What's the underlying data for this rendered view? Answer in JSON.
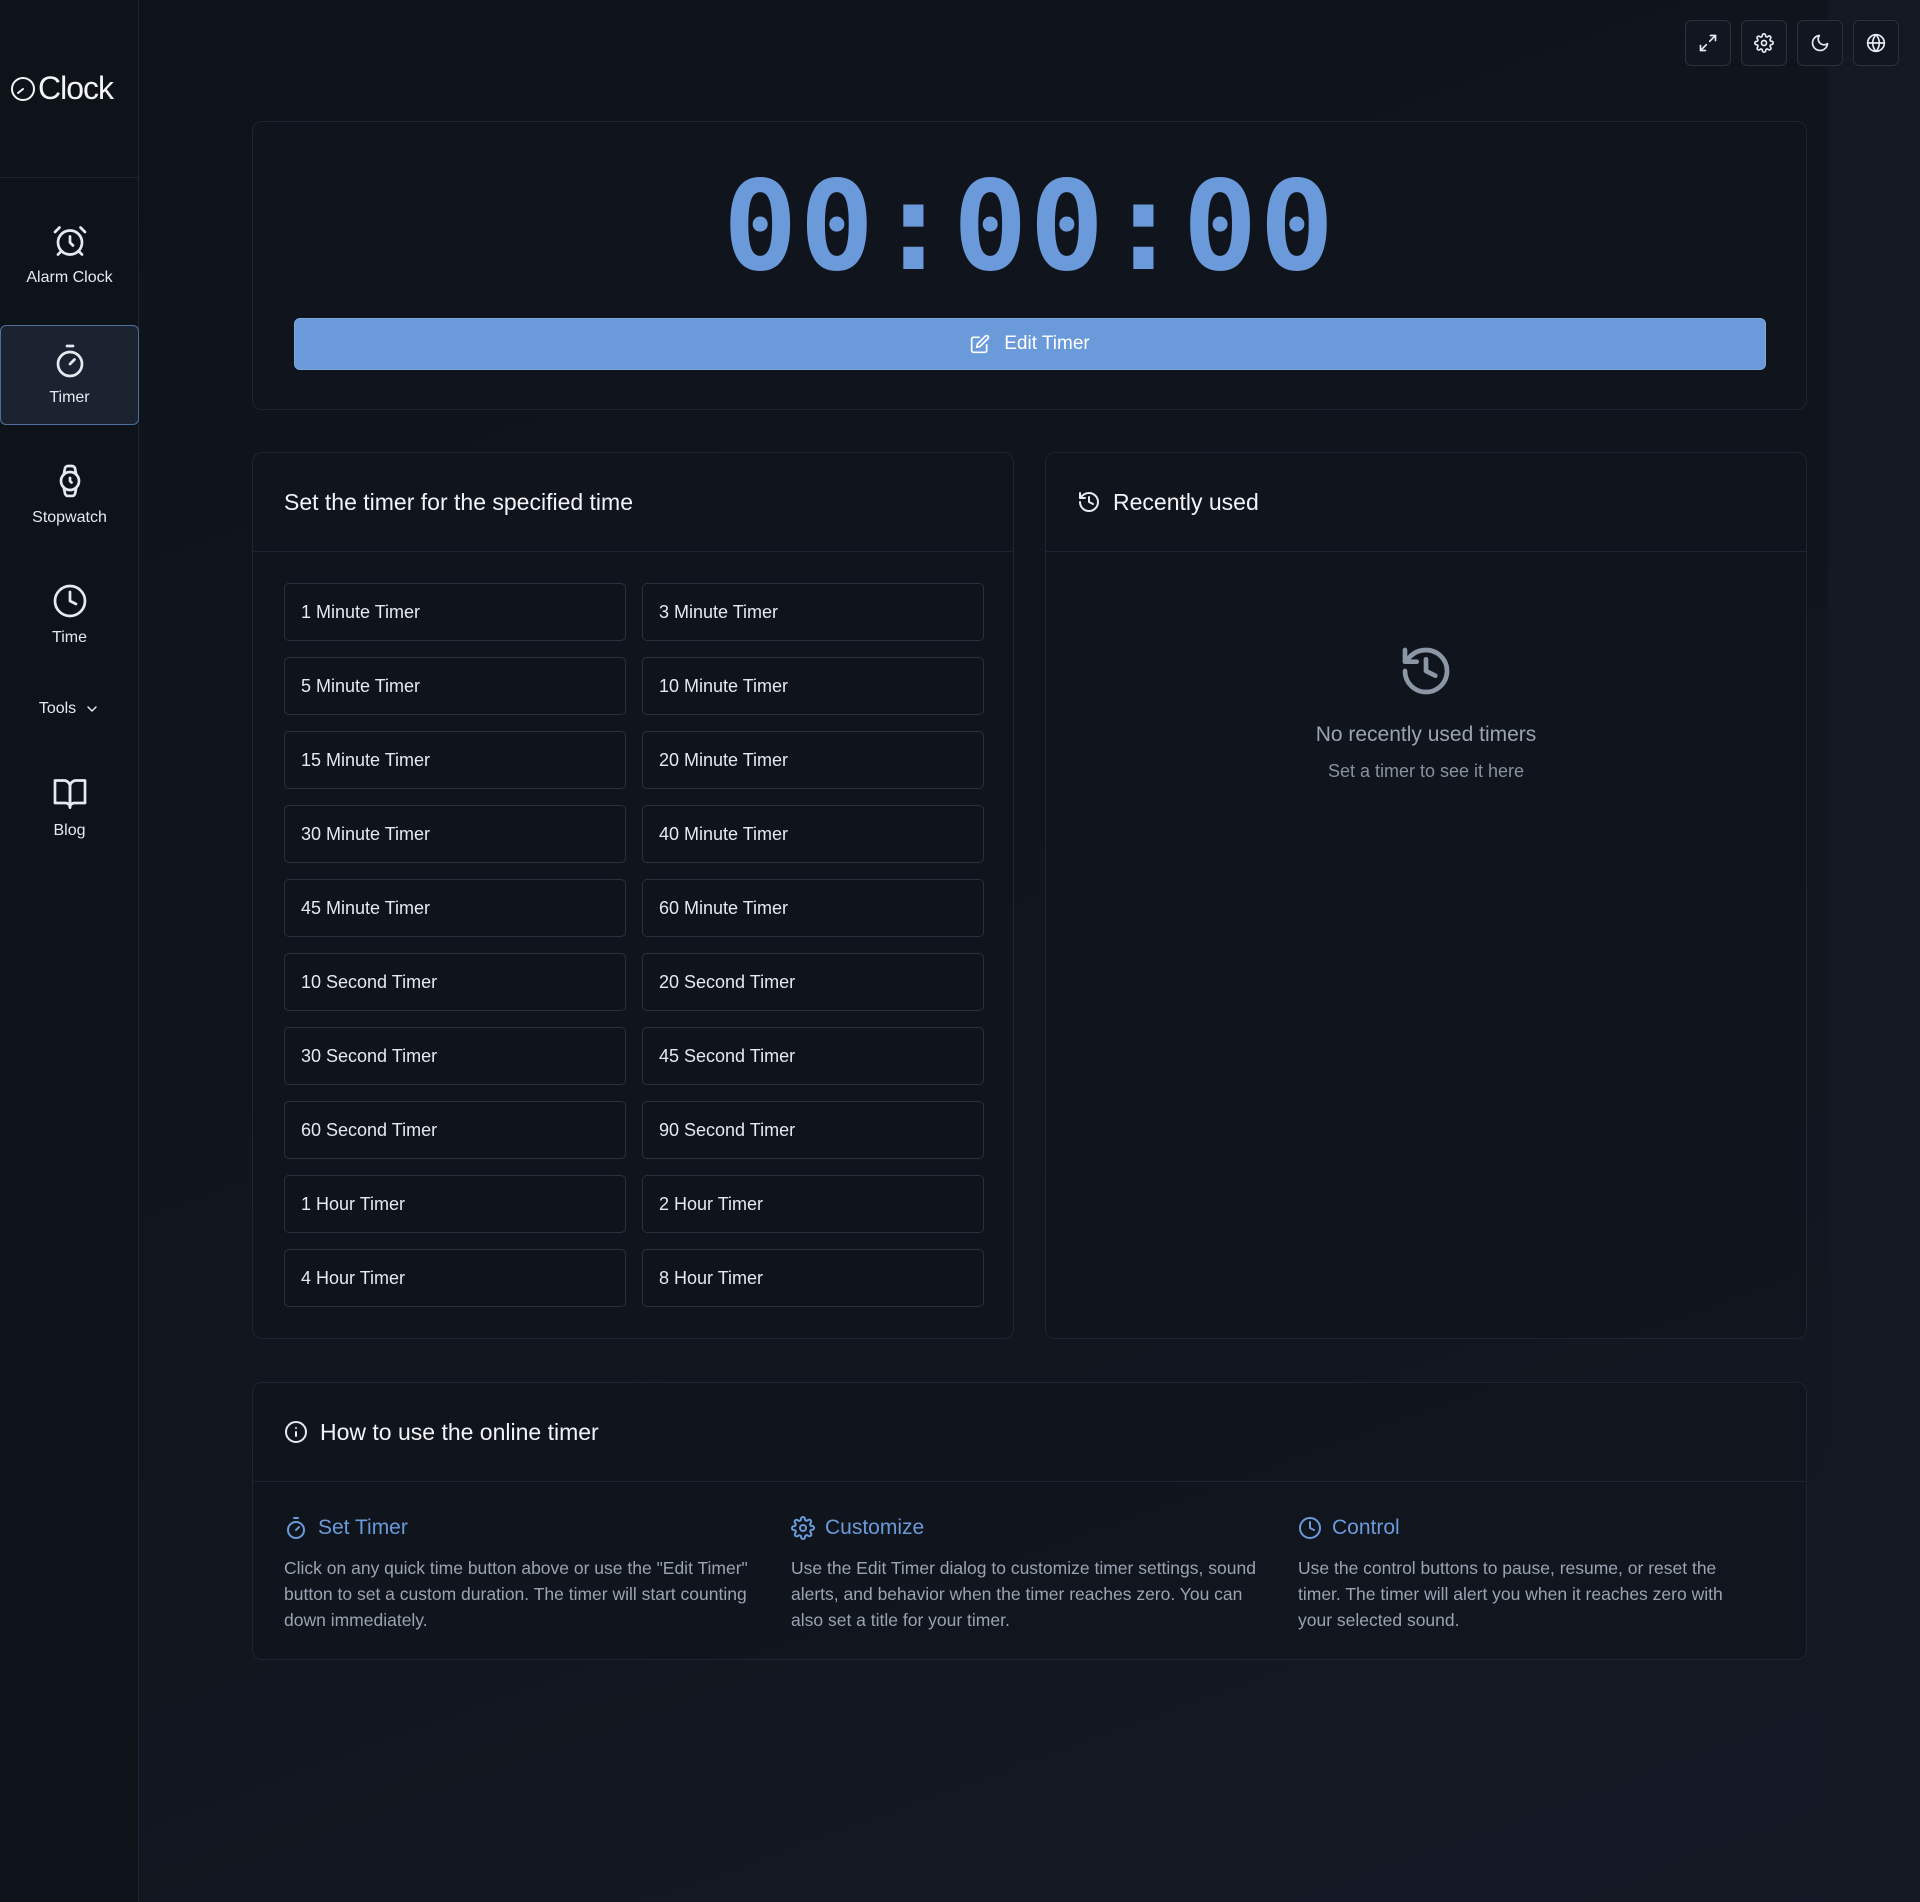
{
  "app": {
    "logo_text": "Clock"
  },
  "sidebar": {
    "items": [
      {
        "label": "Alarm Clock",
        "icon": "alarm-clock-icon"
      },
      {
        "label": "Timer",
        "icon": "timer-icon",
        "active": true
      },
      {
        "label": "Stopwatch",
        "icon": "stopwatch-icon"
      },
      {
        "label": "Time",
        "icon": "clock-icon"
      }
    ],
    "tools_label": "Tools",
    "blog_label": "Blog"
  },
  "topbar": {
    "buttons": [
      "fullscreen-icon",
      "settings-icon",
      "moon-icon",
      "globe-icon"
    ]
  },
  "timer": {
    "display": "00:00:00",
    "edit_label": "Edit Timer"
  },
  "presets": {
    "title": "Set the timer for the specified time",
    "items": [
      "1 Minute Timer",
      "3 Minute Timer",
      "5 Minute Timer",
      "10 Minute Timer",
      "15 Minute Timer",
      "20 Minute Timer",
      "30 Minute Timer",
      "40 Minute Timer",
      "45 Minute Timer",
      "60 Minute Timer",
      "10 Second Timer",
      "20 Second Timer",
      "30 Second Timer",
      "45 Second Timer",
      "60 Second Timer",
      "90 Second Timer",
      "1 Hour Timer",
      "2 Hour Timer",
      "4 Hour Timer",
      "8 Hour Timer"
    ]
  },
  "recent": {
    "title": "Recently used",
    "empty_title": "No recently used timers",
    "empty_subtitle": "Set a timer to see it here"
  },
  "howto": {
    "title": "How to use the online timer",
    "sections": [
      {
        "title": "Set Timer",
        "icon": "timer-icon",
        "text": "Click on any quick time button above or use the \"Edit Timer\" button to set a custom duration. The timer will start counting down immediately."
      },
      {
        "title": "Customize",
        "icon": "gear-icon",
        "text": "Use the Edit Timer dialog to customize timer settings, sound alerts, and behavior when the timer reaches zero. You can also set a title for your timer."
      },
      {
        "title": "Control",
        "icon": "clock-icon",
        "text": "Use the control buttons to pause, resume, or reset the timer. The timer will alert you when it reaches zero with your selected sound."
      }
    ]
  },
  "colors": {
    "accent": "#6a9ad9",
    "background": "#0f131a",
    "card_border": "#1e2430"
  }
}
